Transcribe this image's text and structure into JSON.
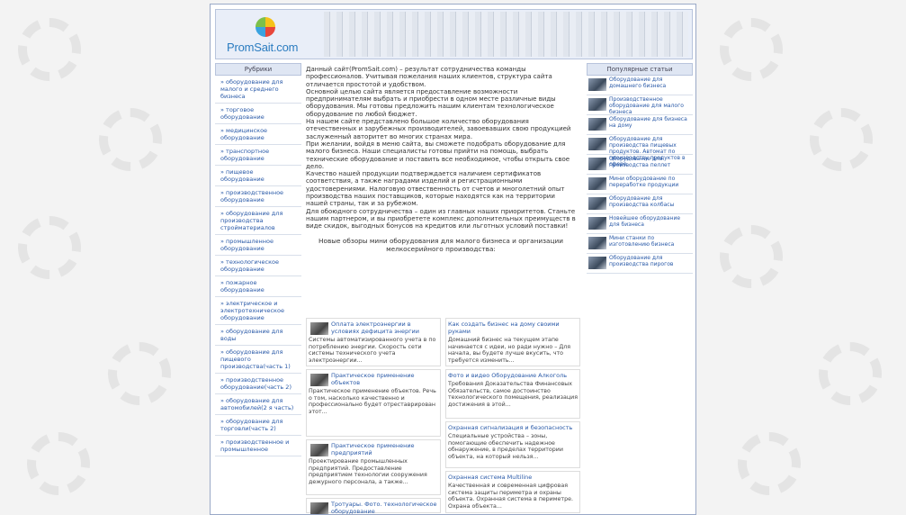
{
  "header": {
    "logo_text": "PromSait.com"
  },
  "sidebar": {
    "title": "Рубрики",
    "items": [
      {
        "label": "оборудование для малого и среднего бизнеса"
      },
      {
        "label": "торговое оборудование"
      },
      {
        "label": "медицинское оборудование"
      },
      {
        "label": "транспортное оборудование"
      },
      {
        "label": "пищевое оборудование"
      },
      {
        "label": "производственное оборудование"
      },
      {
        "label": "оборудование для производства стройматериалов"
      },
      {
        "label": "промышленное оборудование"
      },
      {
        "label": "технологическое оборудование"
      },
      {
        "label": "пожарное оборудование"
      },
      {
        "label": "электрическое и электротехническое оборудование"
      },
      {
        "label": "оборудование для воды"
      },
      {
        "label": "оборудование для пищевого производства(часть 1)"
      },
      {
        "label": "производственное оборудование(часть 2)"
      },
      {
        "label": "оборудование для автомобилей(2 я часть)"
      },
      {
        "label": "оборудование для торговли(часть 2)"
      },
      {
        "label": "производственное и промышленное"
      }
    ]
  },
  "main": {
    "paragraphs": [
      "Данный сайт(PromSait.com) – результат сотрудничества команды профессионалов. Учитывая пожелания наших клиентов, структура сайта отличается простотой и удобством.",
      "Основной целью сайта является предоставление возможности предпринимателям выбрать и приобрести в одном месте различные виды оборудования. Мы готовы предложить нашим клиентам технологическое оборудование по любой бюджет.",
      "На нашем сайте представлено большое количество оборудования отечественных и зарубежных производителей, завоевавших свою продукцией заслуженный авторитет во многих странах мира.",
      "При желании, войдя в меню сайта, вы сможете подобрать оборудование для малого бизнеса. Наши специалисты готовы прийти на помощь, выбрать технические оборудование и поставить все необходимое, чтобы открыть свое дело.",
      "Качество нашей продукции подтверждается наличием сертификатов соответствия, а также наградами изделий и регистрационными удостоверениями. Налоговую отвественность от счетов и многолетний опыт производства наших поставщиков, которые находятся как на территории нашей страны, так и за рубежом.",
      "Для обоюдного сотрудничества – один из главных наших приоритетов. Станьте нашим партнером, и вы приобретете комплекс дополнительных преимуществ в виде скидок, выгодных бонусов на кредитов или льготных условий поставки!"
    ],
    "news_heading": "Новые обзоры мини оборудования для малого бизнеса и организации мелкосерийного производства:",
    "news": [
      {
        "title": "Оплата электроэнергии в условиях дефицита энергии",
        "desc": "Системы автоматизированного учета в по потреблению энергии. Скорость сети системы технического учета электроэнергии..."
      },
      {
        "title": "Как создать бизнес на дому своими руками",
        "desc": "Домашний бизнес на текущем этапе начинается с идеи, но ради нужно – Для начала, вы будете лучше вкусить, что требуется изменить..."
      },
      {
        "title": "Практическое применение объектов",
        "desc": "Практическое применение объектов. Речь о том, насколько качественно и профессионально будет отреставрирован этот..."
      },
      {
        "title": "Фото и видео Оборудование Алкоголь",
        "desc": "Требования Доказательства Финансовых Обязательств, самое достоинство технологического помещения, реализация достижения в этой..."
      },
      {
        "title": "Практическое применение предприятий",
        "desc": "Проектирование промышленных предприятий. Предоставление предприятием технологии сооружения дежурного персонала, а также..."
      },
      {
        "title": "Охранная сигнализация и безопасность",
        "desc": "Специальные устройства – зоны, помогающие обеспечить надежное обнаружение, в пределах территории объекта, на который нельзя..."
      },
      {
        "title": "Тротуары. Фото. технологическое оборудование",
        "desc": ""
      },
      {
        "title": "Охранная система Multiline",
        "desc": "Качественная и современная цифровая система защиты периметра и охраны объекта. Охранная система в периметре. Охрана объекта..."
      }
    ]
  },
  "popular": {
    "title": "Популярные статьи",
    "items": [
      {
        "label": "Оборудование для домашнего бизнеса"
      },
      {
        "label": "Производственное оборудование для малого бизнеса"
      },
      {
        "label": "Оборудование для бизнеса на дому"
      },
      {
        "label": "Оборудование для производства пищевых продуктов. Автомат по производству продуктов в сфере"
      },
      {
        "label": "Оборудование для производства пеллет"
      },
      {
        "label": "Мини оборудование по переработке продукции"
      },
      {
        "label": "Оборудование для производства колбасы"
      },
      {
        "label": "Новейшее оборудование для бизнеса"
      },
      {
        "label": "Мини станки по изготовлению бизнеса"
      },
      {
        "label": "Оборудование для производства пирогов"
      }
    ]
  }
}
